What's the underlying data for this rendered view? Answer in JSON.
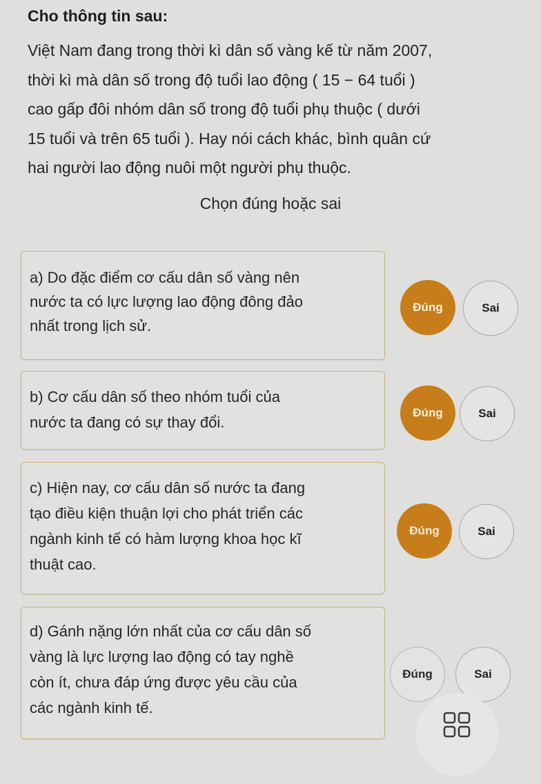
{
  "header": {
    "title": "Cho thông tin sau:",
    "paragraph_lines": [
      "Việt Nam đang trong thời kì dân số vàng kế từ năm 2007,",
      "thời kì mà dân số trong độ tuổi lao động ( 15 − 64 tuổi )",
      "cao gấp đôi nhóm dân số trong độ tuổi phụ thuộc ( dưới",
      "15 tuổi và trên 65 tuổi ). Hay nói cách khác, bình quân cứ",
      "hai người lao động nuôi một người phụ thuộc."
    ],
    "subtitle": "Chọn đúng hoặc sai"
  },
  "statements": [
    {
      "lines": [
        "a) Do đặc điểm cơ cấu dân số vàng nên",
        "nước ta có lực lượng lao động đông đảo",
        "nhất trong lịch sử."
      ],
      "true_label": "Đúng",
      "false_label": "Sai",
      "selected": "Đúng"
    },
    {
      "lines": [
        "b) Cơ cấu dân số theo nhóm tuổi của",
        "nước ta đang có sự thay đổi."
      ],
      "true_label": "Đúng",
      "false_label": "Sai",
      "selected": "Đúng"
    },
    {
      "lines": [
        "c) Hiện nay, cơ cấu dân số nước ta đang",
        "tạo điều kiện thuận lợi cho phát triển các",
        "ngành kinh tế có hàm lượng khoa học kĩ",
        "thuật cao."
      ],
      "true_label": "Đúng",
      "false_label": "Sai",
      "selected": "Đúng"
    },
    {
      "lines": [
        "d) Gánh nặng lớn nhất của cơ cấu dân số",
        "vàng là lực lượng lao động có tay nghề",
        "còn ít, chưa đáp ứng được yêu cầu của",
        "các ngành kinh tế."
      ],
      "true_label": "Đúng",
      "false_label": "Sai",
      "selected": ""
    }
  ],
  "colors": {
    "selected_true": "#c77d19",
    "background": "#dfe0de",
    "card_border": "#c8b37a"
  },
  "icons": {
    "menu": "grid-icon"
  }
}
